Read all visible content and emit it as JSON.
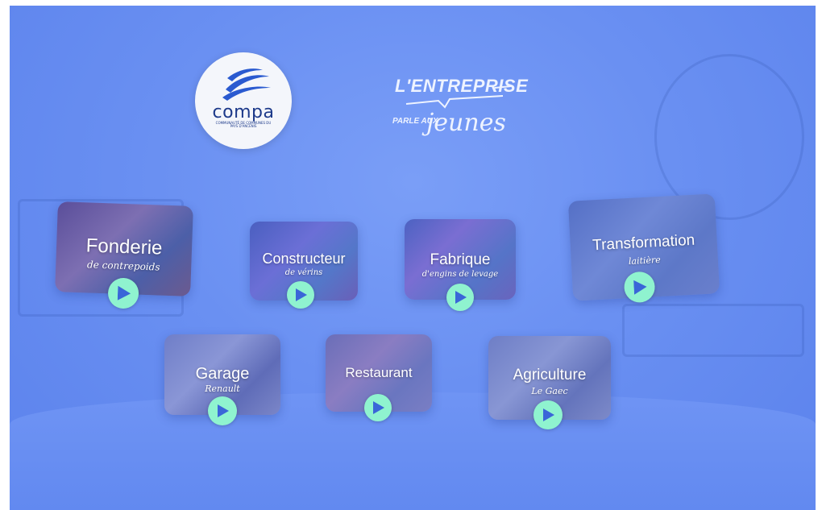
{
  "header": {
    "logo_name": "compa",
    "logo_subtitle": "COMMUNAUTÉ DE COMMUNES DU PAYS D'ANCENIS",
    "brand_line1": "L'ENTREPRISE",
    "brand_line2": "PARLE AUX",
    "brand_line3": "jeunes"
  },
  "tours": [
    {
      "title": "Fonderie",
      "subtitle": "de contrepoids",
      "icon": "play-icon"
    },
    {
      "title": "Constructeur",
      "subtitle": "de vérins",
      "icon": "play-icon"
    },
    {
      "title": "Fabrique",
      "subtitle": "d'engins de levage",
      "icon": "play-icon"
    },
    {
      "title": "Transformation",
      "subtitle": "laitière",
      "icon": "play-icon"
    },
    {
      "title": "Garage",
      "subtitle": "Renault",
      "icon": "play-icon"
    },
    {
      "title": "Restaurant",
      "subtitle": "",
      "icon": "play-icon"
    },
    {
      "title": "Agriculture",
      "subtitle": "Le Gaec",
      "icon": "play-icon"
    }
  ],
  "colors": {
    "background": "#6a90f2",
    "play_button": "#8ff3cf",
    "play_triangle": "#3a66d8"
  }
}
